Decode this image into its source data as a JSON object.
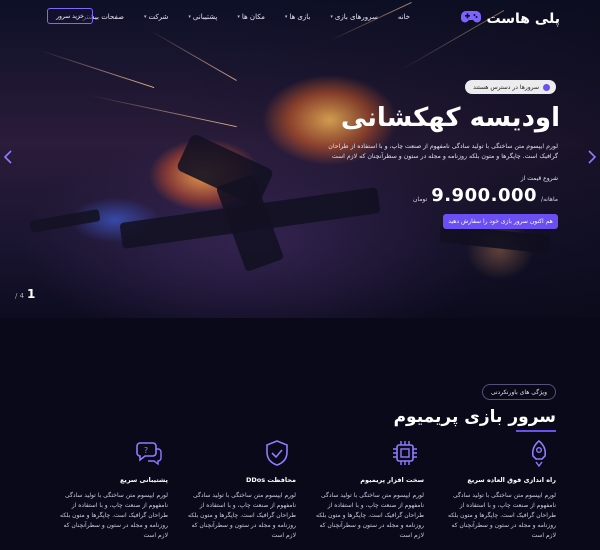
{
  "brand": {
    "name": "پلی هاست",
    "logo_icon": "gamepad-icon",
    "accent": "#6c4ff2"
  },
  "nav": {
    "items": [
      {
        "label": "خانه",
        "has_dropdown": false
      },
      {
        "label": "سرورهای بازی",
        "has_dropdown": true
      },
      {
        "label": "بازی ها",
        "has_dropdown": true
      },
      {
        "label": "مکان ها",
        "has_dropdown": true
      },
      {
        "label": "پشتیبانی",
        "has_dropdown": true
      },
      {
        "label": "شرکت",
        "has_dropdown": true
      },
      {
        "label": "صفحات بیشتر",
        "has_dropdown": true
      }
    ],
    "buy_button": "خرید سرور"
  },
  "hero": {
    "badge": "سرورها در دسترس هستند",
    "title": "اودیسه کهکشانی",
    "description": "لورم ایپسوم متن ساختگی با تولید سادگی نامفهوم از صنعت چاپ، و با استفاده از طراحان گرافیک است. چاپگرها و متون بلکه روزنامه و مجله در ستون و سطرآنچنان که لازم است",
    "price_label": "شروع قیمت از",
    "price_unit": "ماهانه/",
    "price_value": "9.900.000",
    "price_currency": "تومان",
    "cta": "هم اکنون سرور بازی خود را سفارش دهید",
    "slide_current": "1",
    "slide_total": "/ 4",
    "prev_icon": "chevron-left-icon",
    "next_icon": "chevron-right-icon"
  },
  "features": {
    "badge": "ویژگی های باورنکردنی",
    "title": "سرور بازی پریمیوم",
    "cards": [
      {
        "icon": "rocket-icon",
        "title": "راه اندازی فوق العاده سریع",
        "desc": "لورم ایپسوم متن ساختگی با تولید سادگی نامفهوم از صنعت چاپ، و با استفاده از طراحان گرافیک است. چاپگرها و متون بلکه روزنامه و مجله در ستون و سطرآنچنان که لازم است"
      },
      {
        "icon": "cpu-icon",
        "title": "سخت افزار پریمیوم",
        "desc": "لورم ایپسوم متن ساختگی با تولید سادگی نامفهوم از صنعت چاپ، و با استفاده از طراحان گرافیک است. چاپگرها و متون بلکه روزنامه و مجله در ستون و سطرآنچنان که لازم است"
      },
      {
        "icon": "shield-check-icon",
        "title": "محافظت DDos",
        "desc": "لورم ایپسوم متن ساختگی با تولید سادگی نامفهوم از صنعت چاپ، و با استفاده از طراحان گرافیک است. چاپگرها و متون بلکه روزنامه و مجله در ستون و سطرآنچنان که لازم است"
      },
      {
        "icon": "chat-support-icon",
        "title": "پشتیبانی سریع",
        "desc": "لورم ایپسوم متن ساختگی با تولید سادگی نامفهوم از صنعت چاپ، و با استفاده از طراحان گرافیک است. چاپگرها و متون بلکه روزنامه و مجله در ستون و سطرآنچنان که لازم است"
      }
    ]
  }
}
